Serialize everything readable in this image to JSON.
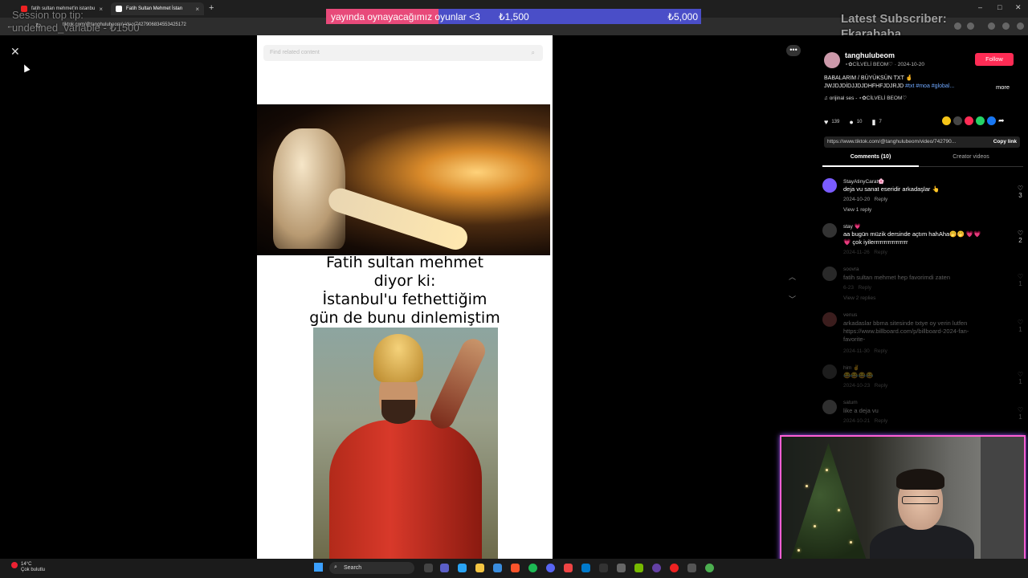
{
  "browser": {
    "tabs": [
      {
        "label": "fatih sultan mehmet'in istanbu",
        "active": false,
        "favicon_color": "#e22"
      },
      {
        "label": "Fatih Sultan Mehmet İstan",
        "active": true,
        "favicon_color": "#fff"
      }
    ],
    "url": "tiktok.com/@tanghulubeom/video/7427906834553425172"
  },
  "overlays": {
    "session_tip": "Session top tip:\nundefined_variable - ₺1500",
    "latest_subscriber": "Latest Subscriber:\nFkarababa",
    "goal": {
      "text": "yayında oynayacağımız oyunlar <3",
      "current": "₺1,500",
      "target": "₺5,000",
      "progress": 0.3
    }
  },
  "video": {
    "search_placeholder": "Find related content",
    "caption": "Fatih sultan mehmet\ndiyor ki:\nİstanbul'u fethettiğim\ngün de bunu dinlemiştim"
  },
  "post": {
    "author": "tanghulubeom",
    "subline": "⋆✿CİLVELİ BEOM♡ · 2024-10-20",
    "follow_label": "Follow",
    "description": "BABALARIM / BÜYÜKSÜN TXT 🤞 JWJDJDİDJJDJDHFHFJDJRJD",
    "hashtags": "#txt #moa #global...",
    "more_label": "more",
    "music": "orijinal ses - ⋆✿CİLVELİ BEOM♡",
    "likes": "139",
    "comments_count": "10",
    "saves": "7",
    "link": "https://www.tiktok.com/@tanghulubeom/video/742790...",
    "copy_label": "Copy link",
    "tab_comments": "Comments (10)",
    "tab_creator": "Creator videos"
  },
  "comments": [
    {
      "user": "StayAtinyCarat🌸",
      "text": "deja vu sanat eseridir arkadaşlar 👆",
      "date": "2024-10-20",
      "reply": "Reply",
      "likes": "3",
      "view_replies": "View 1 reply",
      "avatar_color": "#7a5cff"
    },
    {
      "user": "stay 💗",
      "text": "aa bugün müzik dersinde açtım hahAha🤭🤭 💗💗💗 çok iyilerrrrrrrrrrrrrrrrr",
      "date": "2024-11-26",
      "reply": "Reply",
      "likes": "2",
      "avatar_color": "#333"
    },
    {
      "user": "soovra",
      "text": "fatih sultan mehmet hep favorimdi zaten",
      "date": "6-23",
      "reply": "Reply",
      "likes": "1",
      "view_replies": "View 2 replies",
      "avatar_color": "#777"
    },
    {
      "user": "venus",
      "text": "arkadaslar bbma sitesinde txtye oy verin lutfen https://www.billboard.com/p/billboard-2024-fan-favorite-",
      "date": "2024-11-30",
      "reply": "Reply",
      "likes": "1",
      "avatar_color": "#a55"
    },
    {
      "user": "him ✌",
      "text": "😂😂😂😂",
      "date": "2024-10-23",
      "reply": "Reply",
      "likes": "1",
      "avatar_color": "#555"
    },
    {
      "user": "satum",
      "text": "like a deja vu",
      "date": "2024-10-21",
      "reply": "Reply",
      "likes": "1",
      "avatar_color": "#888"
    }
  ],
  "taskbar": {
    "temperature": "14°C",
    "weather": "Çok bulutlu",
    "search_placeholder": "Search"
  }
}
